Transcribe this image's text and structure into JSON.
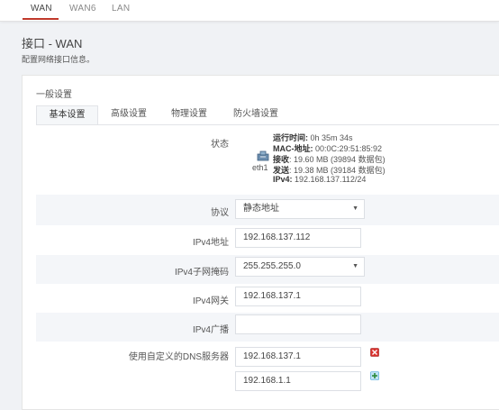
{
  "top_tabs": [
    "WAN",
    "WAN6",
    "LAN"
  ],
  "page_title": "接口 - WAN",
  "page_description": "配置网络接口信息。",
  "section_title": "一般设置",
  "subtabs": [
    "基本设置",
    "高级设置",
    "物理设置",
    "防火墙设置"
  ],
  "status": {
    "label": "状态",
    "iface_name": "eth1",
    "uptime_key": "运行时间:",
    "uptime_val": " 0h 35m 34s",
    "mac_key": "MAC-地址:",
    "mac_val": " 00:0C:29:51:85:92",
    "rx_key": "接收",
    "rx_val": ": 19.60 MB (39894 数据包)",
    "tx_key": "发送",
    "tx_val": ": 19.38 MB (39184 数据包)",
    "ipv4_key": "IPv4:",
    "ipv4_val": " 192.168.137.112/24"
  },
  "fields": {
    "protocol_label": "协议",
    "protocol_value": "静态地址",
    "ipv4_addr_label": "IPv4地址",
    "ipv4_addr_value": "192.168.137.112",
    "netmask_label": "IPv4子网掩码",
    "netmask_value": "255.255.255.0",
    "gateway_label": "IPv4网关",
    "gateway_value": "192.168.137.1",
    "broadcast_label": "IPv4广播",
    "broadcast_value": "",
    "dns_label": "使用自定义的DNS服务器",
    "dns_values": [
      "192.168.137.1",
      "192.168.1.1"
    ]
  },
  "colors": {
    "accent": "#c0392b",
    "remove": "#d9302c",
    "add": "#3a9bd5"
  },
  "icons": {
    "remove": "remove-icon",
    "add": "add-icon",
    "network": "network-port-icon",
    "dropdown": "chevron-down-icon"
  }
}
